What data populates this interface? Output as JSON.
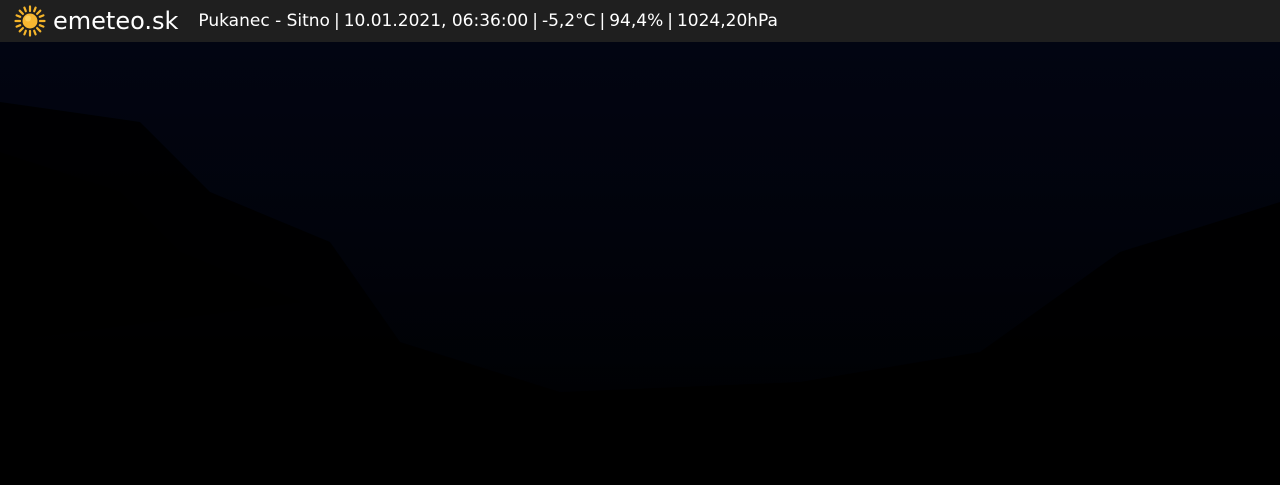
{
  "brand": {
    "icon": "sun-icon",
    "name": "emeteo.sk",
    "icon_color": "#f5b52a"
  },
  "station": {
    "location": "Pukanec - Sitno",
    "datetime": "10.01.2021, 06:36:00",
    "temperature": "-5,2°C",
    "humidity": "94,4%",
    "pressure": "1024,20hPa",
    "separator": "|"
  },
  "colors": {
    "header_bg": "#1f1f1f",
    "text": "#ffffff",
    "sky": "#01020a"
  }
}
